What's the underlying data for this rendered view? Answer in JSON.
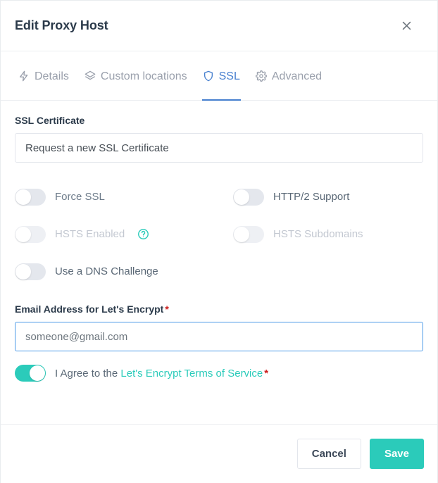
{
  "header": {
    "title": "Edit Proxy Host",
    "close_icon": "close-icon"
  },
  "tabs": [
    {
      "label": "Details",
      "icon": "bolt-icon",
      "active": false
    },
    {
      "label": "Custom locations",
      "icon": "layers-icon",
      "active": false
    },
    {
      "label": "SSL",
      "icon": "shield-icon",
      "active": true
    },
    {
      "label": "Advanced",
      "icon": "gear-icon",
      "active": false
    }
  ],
  "ssl_certificate": {
    "label": "SSL Certificate",
    "selected": "Request a new SSL Certificate"
  },
  "toggles": [
    {
      "label": "Force SSL",
      "state": "off",
      "style": "normal"
    },
    {
      "label": "HTTP/2 Support",
      "state": "off",
      "style": "dark"
    },
    {
      "label": "HSTS Enabled",
      "state": "off",
      "style": "dim",
      "help_icon": "help-circle-icon"
    },
    {
      "label": "HSTS Subdomains",
      "state": "off",
      "style": "dim"
    },
    {
      "label": "Use a DNS Challenge",
      "state": "off",
      "style": "dark"
    }
  ],
  "email": {
    "label": "Email Address for Let's Encrypt",
    "required_marker": "*",
    "value": "someone@gmail.com",
    "placeholder": "someone@gmail.com"
  },
  "agree": {
    "state": "on",
    "prefix": "I Agree to the",
    "link_text": "Let's Encrypt Terms of Service",
    "required_marker": "*"
  },
  "footer": {
    "cancel_label": "Cancel",
    "save_label": "Save"
  },
  "colors": {
    "accent_teal": "#2bcbba",
    "accent_blue": "#467fcf",
    "focus_blue": "#4c9ae8",
    "required_red": "#cd201f",
    "title_dark": "#2b3a4a",
    "muted": "#9aa0ac"
  }
}
